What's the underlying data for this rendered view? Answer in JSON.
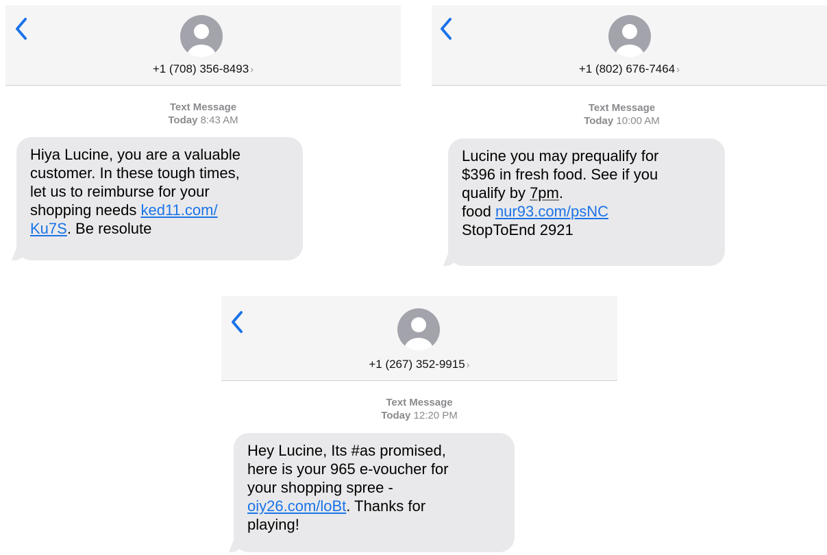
{
  "accent_color": "#1a73e8",
  "bubble_color": "#e9e9eb",
  "threads": [
    {
      "contact": "+1 (708) 356-8493",
      "kind": "Text Message",
      "day": "Today",
      "time": "8:43 AM",
      "message": {
        "lines": [
          "Hiya Lucine, you are a valuable",
          "customer. In these tough times,",
          "let us to reimburse for your"
        ],
        "pre_link": "shopping needs ",
        "link_part1": "ked11.com/",
        "link_part2": "Ku7S",
        "post_link": ". Be resolute"
      }
    },
    {
      "contact": "+1 (802) 676-7464",
      "kind": "Text Message",
      "day": "Today",
      "time": "10:00 AM",
      "message": {
        "line1": "Lucine you may prequalify for",
        "line2": "$396 in fresh food. See if you",
        "line3_pre": "qualify by ",
        "line3_time": "7pm",
        "line3_post": ".",
        "line4_pre": "food ",
        "link": "nur93.com/psNC",
        "line5": "StopToEnd 2921"
      }
    },
    {
      "contact": "+1 (267) 352-9915",
      "kind": "Text Message",
      "day": "Today",
      "time": "12:20 PM",
      "message": {
        "line1": "Hey Lucine, Its #as promised,",
        "line2": "here is your 965 e-voucher for",
        "line3": "your shopping spree -",
        "link": "oiy26.com/loBt",
        "post_link": ". Thanks for",
        "line5": "playing!"
      }
    }
  ],
  "icons": {
    "back": "chevron-left-icon",
    "avatar": "person-avatar-icon",
    "contact_chevron": "chevron-right-icon"
  }
}
